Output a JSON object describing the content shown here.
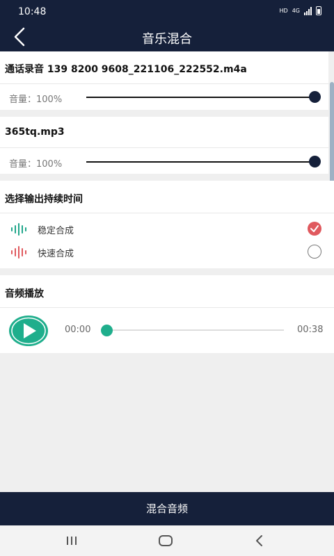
{
  "status_bar": {
    "time": "10:48",
    "hd_label": "HD",
    "network_label": "4G"
  },
  "app_bar": {
    "title": "音乐混合",
    "back_icon": "back-arrow-icon"
  },
  "tracks": [
    {
      "file_name": "通话录音 139 8200 9608_221106_222552.m4a",
      "volume_label": "音量：100%",
      "volume": 1.0
    },
    {
      "file_name": "365tq.mp3",
      "volume_label": "音量：100%",
      "volume": 1.0
    }
  ],
  "duration_section": {
    "title": "选择输出持续时间",
    "options": [
      {
        "label": "稳定合成",
        "selected": true,
        "icon": "waveform-icon",
        "color": "#20a68a"
      },
      {
        "label": "快速合成",
        "selected": false,
        "icon": "waveform-icon",
        "color": "#e0595e"
      }
    ]
  },
  "playback": {
    "title": "音频播放",
    "current_time": "00:00",
    "total_time": "00:38",
    "progress": 0.0,
    "play_icon": "play-icon"
  },
  "action": {
    "label": "混合音频"
  },
  "colors": {
    "primary": "#15203a",
    "accent_green": "#20a68a",
    "accent_red": "#e0595e",
    "background": "#efefef"
  },
  "nav": {
    "recents_icon": "recents-icon",
    "home_icon": "home-icon",
    "back_icon": "back-icon"
  }
}
